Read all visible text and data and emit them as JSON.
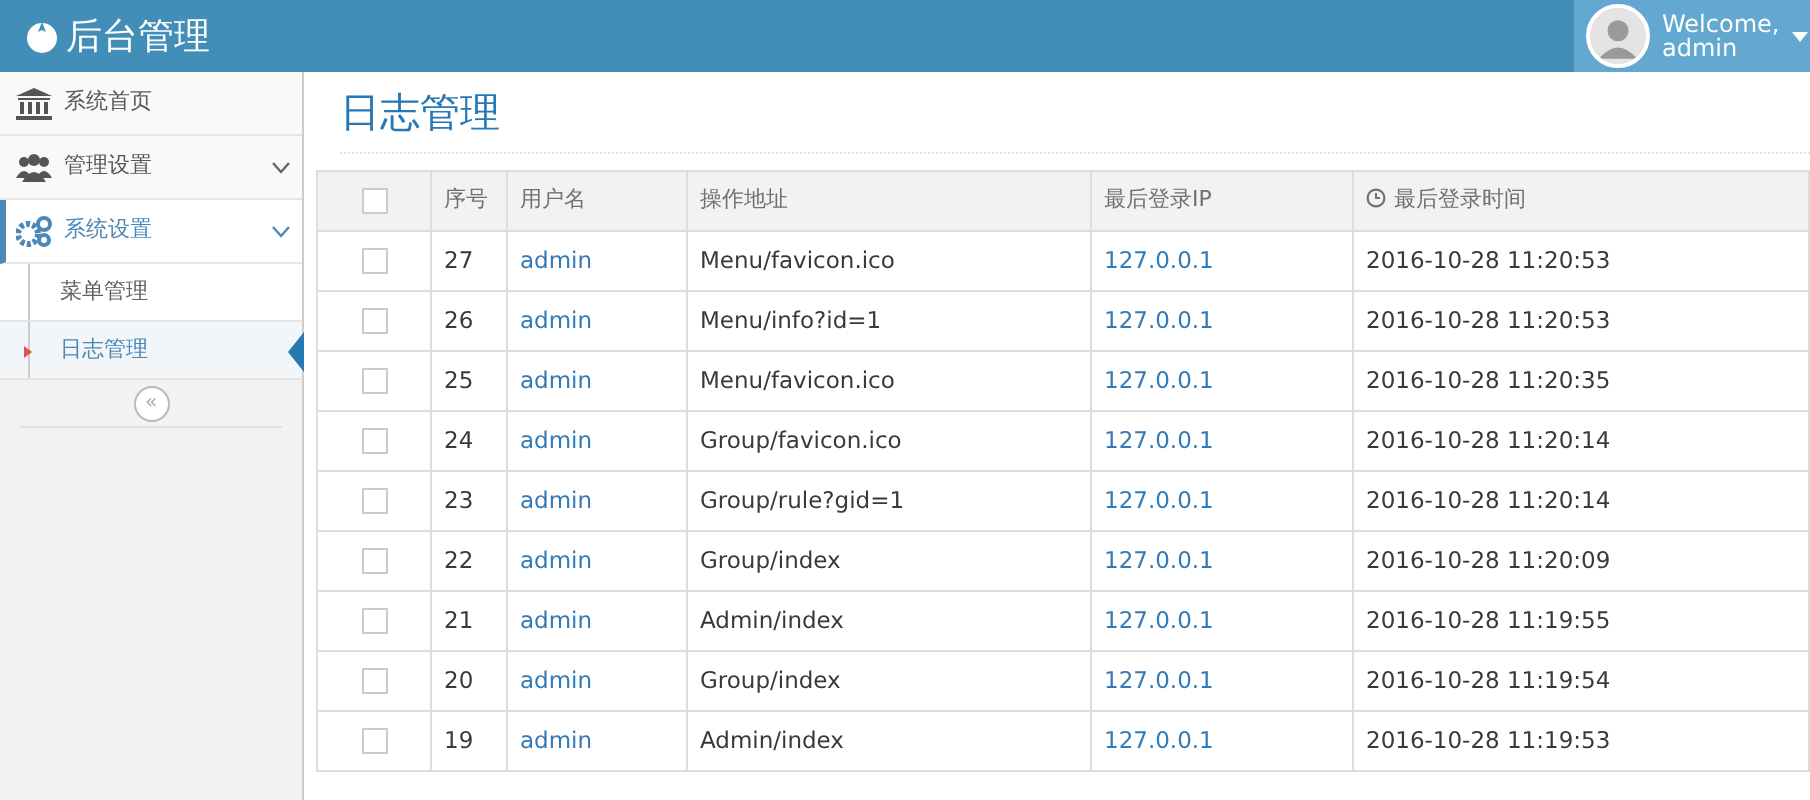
{
  "brand": "后台管理",
  "user": {
    "greeting": "Welcome,",
    "name": "admin"
  },
  "sidebar": {
    "items": [
      {
        "label": "系统首页",
        "kind": "link"
      },
      {
        "label": "管理设置",
        "kind": "menu",
        "expanded": false
      },
      {
        "label": "系统设置",
        "kind": "menu",
        "expanded": true,
        "children": [
          {
            "label": "菜单管理",
            "selected": false
          },
          {
            "label": "日志管理",
            "selected": true
          }
        ]
      }
    ],
    "collapse": "«"
  },
  "page_title": "日志管理",
  "table": {
    "select_all": {
      "checked": false
    },
    "columns": [
      {
        "kind": "text",
        "label": "序号"
      },
      {
        "kind": "link",
        "label": "用户名"
      },
      {
        "kind": "text",
        "label": "操作地址"
      },
      {
        "kind": "link",
        "label": "最后登录IP"
      },
      {
        "kind": "time",
        "label": "最后登录时间"
      }
    ],
    "rows": [
      {
        "checked": false,
        "cells": [
          "27",
          "admin",
          "Menu/favicon.ico",
          "127.0.0.1",
          "2016-10-28 11:20:53"
        ]
      },
      {
        "checked": false,
        "cells": [
          "26",
          "admin",
          "Menu/info?id=1",
          "127.0.0.1",
          "2016-10-28 11:20:53"
        ]
      },
      {
        "checked": false,
        "cells": [
          "25",
          "admin",
          "Menu/favicon.ico",
          "127.0.0.1",
          "2016-10-28 11:20:35"
        ]
      },
      {
        "checked": false,
        "cells": [
          "24",
          "admin",
          "Group/favicon.ico",
          "127.0.0.1",
          "2016-10-28 11:20:14"
        ]
      },
      {
        "checked": false,
        "cells": [
          "23",
          "admin",
          "Group/rule?gid=1",
          "127.0.0.1",
          "2016-10-28 11:20:14"
        ]
      },
      {
        "checked": false,
        "cells": [
          "22",
          "admin",
          "Group/index",
          "127.0.0.1",
          "2016-10-28 11:20:09"
        ]
      },
      {
        "checked": false,
        "cells": [
          "21",
          "admin",
          "Admin/index",
          "127.0.0.1",
          "2016-10-28 11:19:55"
        ]
      },
      {
        "checked": false,
        "cells": [
          "20",
          "admin",
          "Group/index",
          "127.0.0.1",
          "2016-10-28 11:19:54"
        ]
      },
      {
        "checked": false,
        "cells": [
          "19",
          "admin",
          "Admin/index",
          "127.0.0.1",
          "2016-10-28 11:19:53"
        ]
      }
    ]
  }
}
